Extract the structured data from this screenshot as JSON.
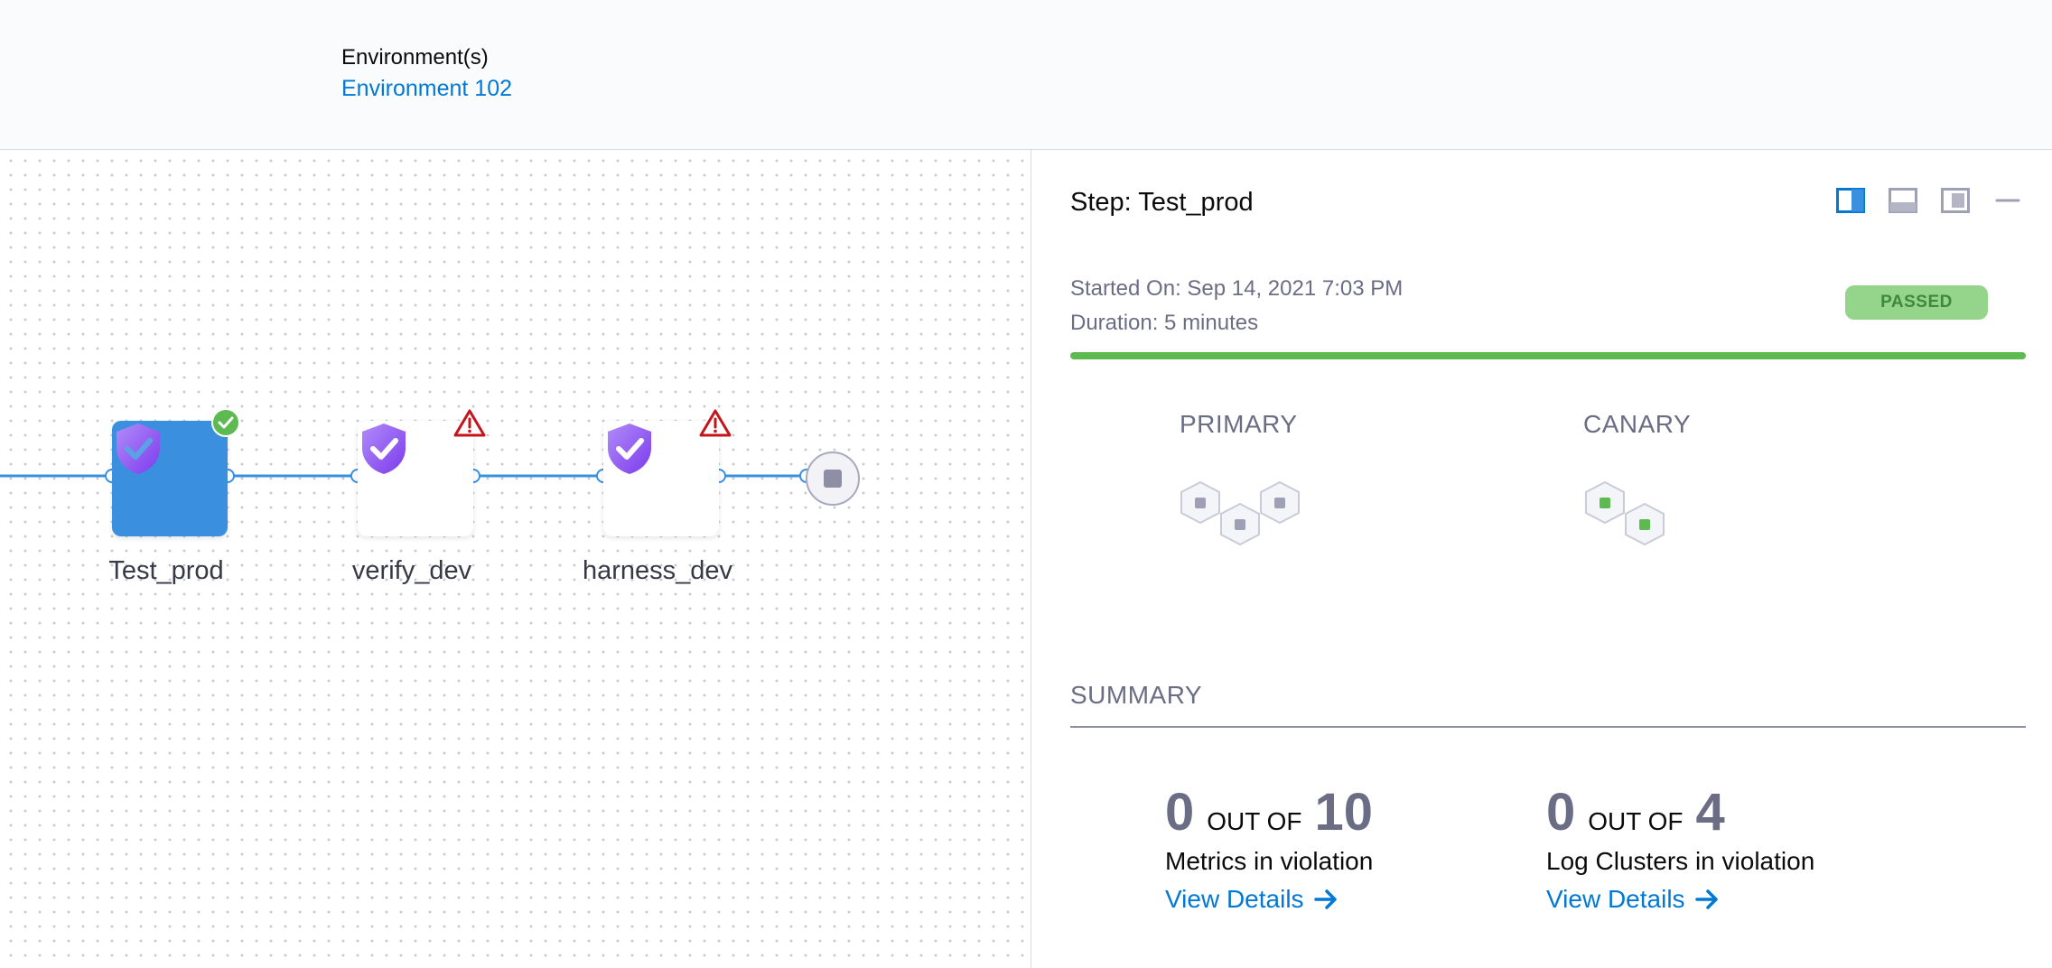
{
  "header": {
    "env_label": "Environment(s)",
    "env_value": "Environment 102"
  },
  "pipeline": {
    "nodes": [
      {
        "label": "Test_prod",
        "status": "success",
        "selected": true,
        "icon": "verify-shield-icon"
      },
      {
        "label": "verify_dev",
        "status": "warning",
        "selected": false,
        "icon": "verify-shield-icon"
      },
      {
        "label": "harness_dev",
        "status": "warning",
        "selected": false,
        "icon": "verify-shield-icon"
      }
    ],
    "end_icon": "stop-icon"
  },
  "panel": {
    "title": "Step: Test_prod",
    "tools": [
      "split-right-icon",
      "split-bottom-icon",
      "float-icon",
      "minimize-icon"
    ],
    "started_on": "Started On: Sep 14, 2021 7:03 PM",
    "duration": "Duration: 5 minutes",
    "status": "PASSED",
    "progress": 1.0,
    "primary": {
      "title": "PRIMARY",
      "nodes": 3
    },
    "canary": {
      "title": "CANARY",
      "nodes": 2
    },
    "summary": {
      "title": "SUMMARY",
      "metrics": {
        "count": "0",
        "out_of": "OUT OF",
        "total": "10",
        "desc": "Metrics in violation",
        "link": "View Details"
      },
      "logs": {
        "count": "0",
        "out_of": "OUT OF",
        "total": "4",
        "desc": "Log Clusters in violation",
        "link": "View Details"
      }
    }
  },
  "colors": {
    "accent": "#0278d5",
    "selected_node": "#3a8fde",
    "success": "#5cba50",
    "warning": "#c4151c",
    "shield": "#8b5cf6"
  }
}
